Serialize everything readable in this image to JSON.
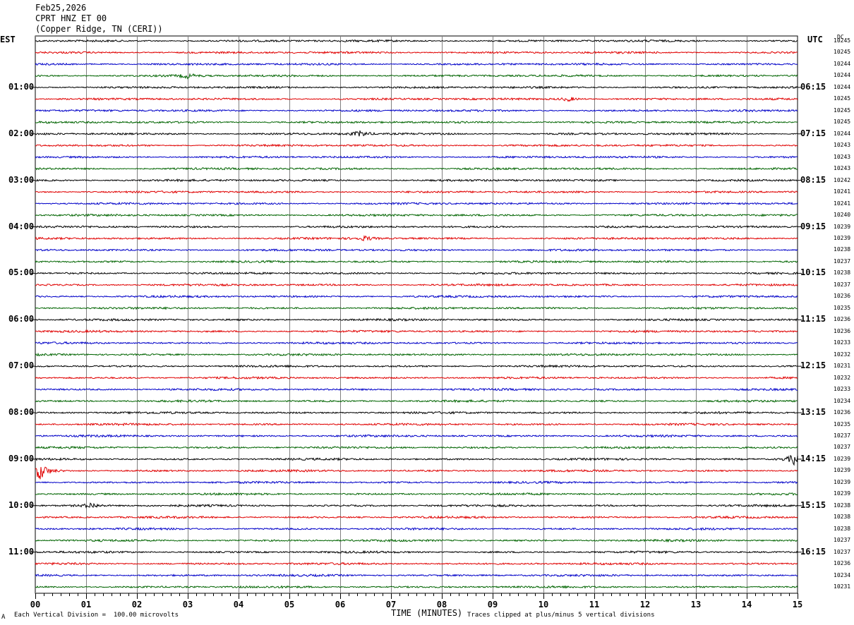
{
  "header": {
    "date": "Feb25,2026",
    "station": "CPRT HNZ ET 00",
    "location": "(Copper Ridge, TN (CERI))"
  },
  "left_tz": "EST",
  "right_tz": "UTC",
  "dc_header": "DC",
  "xlabel": "TIME (MINUTES)",
  "footer": {
    "scale": "Each Vertical Division =  100.00 microvolts",
    "clip": "Traces clipped at plus/minus 5 vertical divisions",
    "mark": "A"
  },
  "colors": {
    "trace_cycle": [
      "#000000",
      "#e00000",
      "#0000c8",
      "#006400"
    ],
    "grid": "#808080"
  },
  "chart_data": {
    "type": "line",
    "xlim": [
      0,
      15
    ],
    "x_ticks": [
      "00",
      "01",
      "02",
      "03",
      "04",
      "05",
      "06",
      "07",
      "08",
      "09",
      "10",
      "11",
      "12",
      "13",
      "14",
      "15"
    ],
    "left_labels": [
      "01:00",
      "02:00",
      "03:00",
      "04:00",
      "05:00",
      "06:00",
      "07:00",
      "08:00",
      "09:00",
      "10:00",
      "11:00"
    ],
    "right_labels": [
      "06:15",
      "07:15",
      "08:15",
      "09:15",
      "10:15",
      "11:15",
      "12:15",
      "13:15",
      "14:15",
      "15:15",
      "16:15"
    ],
    "trace_count": 48,
    "dc_values": [
      "10245",
      "10245",
      "10244",
      "10244",
      "10244",
      "10245",
      "10245",
      "10245",
      "10244",
      "10243",
      "10243",
      "10243",
      "10242",
      "10241",
      "10241",
      "10240",
      "10239",
      "10239",
      "10238",
      "10237",
      "10238",
      "10237",
      "10236",
      "10235",
      "10236",
      "10236",
      "10233",
      "10232",
      "10231",
      "10232",
      "10233",
      "10234",
      "10236",
      "10235",
      "10237",
      "10237",
      "10239",
      "10239",
      "10239",
      "10239",
      "10238",
      "10238",
      "10238",
      "10237",
      "10237",
      "10236",
      "10234",
      "10231"
    ],
    "events": [
      {
        "trace": 36,
        "minute": 14.95,
        "amp": 3.0
      },
      {
        "trace": 37,
        "minute": 0.1,
        "amp": 4.0
      },
      {
        "trace": 8,
        "minute": 6.4,
        "amp": 1.4
      },
      {
        "trace": 5,
        "minute": 10.5,
        "amp": 1.1
      },
      {
        "trace": 3,
        "minute": 3.0,
        "amp": 1.0
      },
      {
        "trace": 40,
        "minute": 1.1,
        "amp": 1.3
      },
      {
        "trace": 17,
        "minute": 6.5,
        "amp": 1.0
      }
    ]
  }
}
